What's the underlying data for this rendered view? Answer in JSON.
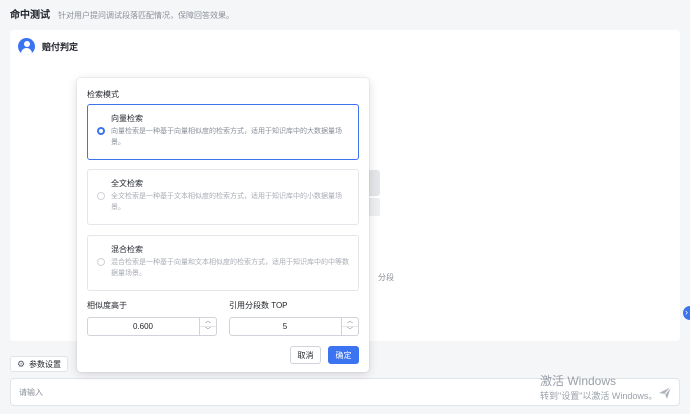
{
  "header": {
    "title": "命中测试",
    "subtitle": "针对用户提问调试段落匹配情况，保障回答效果。"
  },
  "knowledge": {
    "name": "赔付判定"
  },
  "empty_state": {
    "text": "分段"
  },
  "params_button": {
    "label": "参数设置"
  },
  "input": {
    "placeholder": "请输入"
  },
  "watermark": {
    "line1": "激活 Windows",
    "line2": "转到\"设置\"以激活 Windows。"
  },
  "popover": {
    "section_label": "检索模式",
    "modes": [
      {
        "title": "向量检索",
        "desc": "向量检索是一种基于向量相似度的检索方式，适用于知识库中的大数据量场景。",
        "selected": true
      },
      {
        "title": "全文检索",
        "desc": "全文检索是一种基于文本相似度的检索方式，适用于知识库中的小数据量场景。",
        "selected": false
      },
      {
        "title": "混合检索",
        "desc": "混合检索是一种基于向量和文本相似度的检索方式，适用于知识库中的中等数据量场景。",
        "selected": false
      }
    ],
    "similarity": {
      "label": "相似度高于",
      "value": "0.600"
    },
    "top_n": {
      "label": "引用分段数 TOP",
      "value": "5"
    },
    "cancel_label": "取消",
    "confirm_label": "确定"
  },
  "colors": {
    "accent": "#3b73f0",
    "background": "#f5f6f8"
  }
}
